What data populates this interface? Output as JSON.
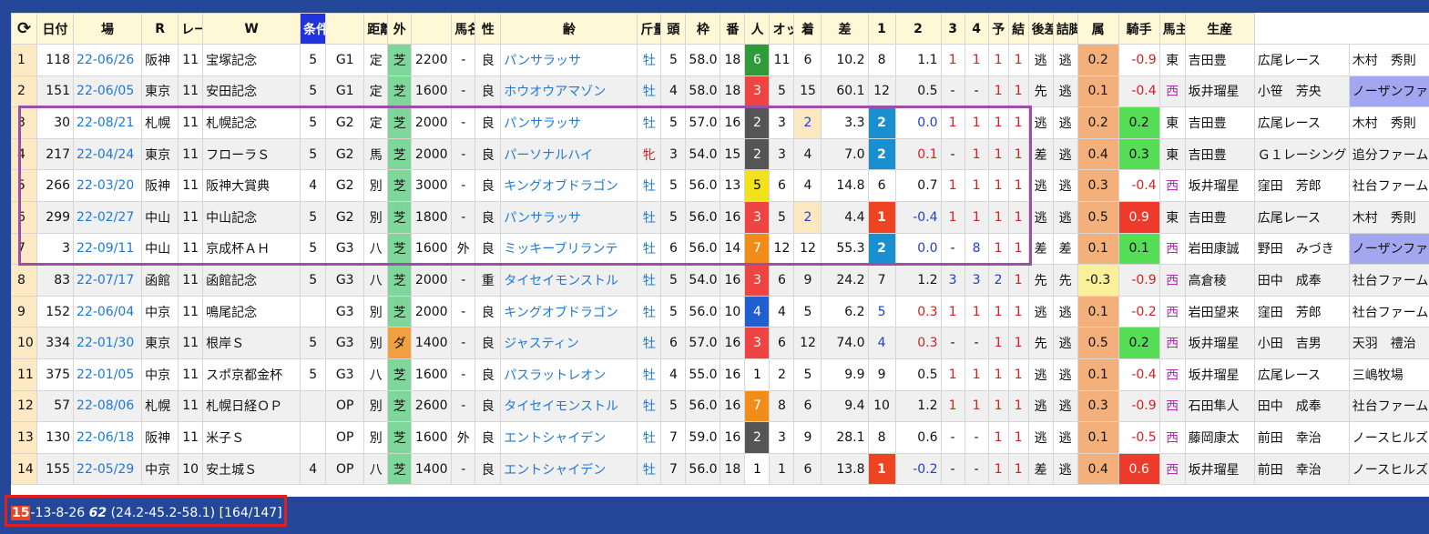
{
  "header": {
    "refresh_icon": "refresh-icon",
    "columns": [
      "",
      "日付",
      "場",
      "R",
      "レース名",
      "W",
      "条件",
      "",
      "距離",
      "外",
      "",
      "馬名",
      "性",
      "齢",
      "斤量",
      "頭",
      "枠",
      "番",
      "人",
      "オッズ",
      "着",
      "差",
      "1",
      "2",
      "3",
      "4",
      "予",
      "結",
      "後差",
      "詰脚",
      "属",
      "騎手",
      "馬主",
      "生産"
    ]
  },
  "rows": [
    [
      "1",
      "118",
      "22-06/26",
      "阪神",
      "11",
      "宝塚記念",
      "5",
      "G1",
      "定",
      "芝",
      "2200",
      "-",
      "良",
      "パンサラッサ",
      "牡",
      "5",
      "58.0",
      "18",
      "6",
      "11",
      "6",
      "10.2",
      "8",
      "1.1",
      "1",
      "1",
      "1",
      "1",
      "逃",
      "逃",
      "0.2",
      "-0.9",
      "東",
      "吉田豊",
      "広尾レース",
      "木村　秀則"
    ],
    [
      "2",
      "151",
      "22-06/05",
      "東京",
      "11",
      "安田記念",
      "5",
      "G1",
      "定",
      "芝",
      "1600",
      "-",
      "良",
      "ホウオウアマゾン",
      "牡",
      "4",
      "58.0",
      "18",
      "3",
      "5",
      "15",
      "60.1",
      "12",
      "0.5",
      "-",
      "-",
      "1",
      "1",
      "先",
      "逃",
      "0.1",
      "-0.4",
      "西",
      "坂井瑠星",
      "小笹　芳央",
      "ノーザンファーム"
    ],
    [
      "3",
      "30",
      "22-08/21",
      "札幌",
      "11",
      "札幌記念",
      "5",
      "G2",
      "定",
      "芝",
      "2000",
      "-",
      "良",
      "パンサラッサ",
      "牡",
      "5",
      "57.0",
      "16",
      "2",
      "3",
      "2",
      "3.3",
      "2",
      "0.0",
      "1",
      "1",
      "1",
      "1",
      "逃",
      "逃",
      "0.2",
      "0.2",
      "東",
      "吉田豊",
      "広尾レース",
      "木村　秀則"
    ],
    [
      "4",
      "217",
      "22-04/24",
      "東京",
      "11",
      "フローラＳ",
      "5",
      "G2",
      "馬",
      "芝",
      "2000",
      "-",
      "良",
      "パーソナルハイ",
      "牝",
      "3",
      "54.0",
      "15",
      "2",
      "3",
      "4",
      "7.0",
      "2",
      "0.1",
      "-",
      "1",
      "1",
      "1",
      "差",
      "逃",
      "0.4",
      "0.3",
      "東",
      "吉田豊",
      "Ｇ１レーシング",
      "追分ファーム"
    ],
    [
      "5",
      "266",
      "22-03/20",
      "阪神",
      "11",
      "阪神大賞典",
      "4",
      "G2",
      "別",
      "芝",
      "3000",
      "-",
      "良",
      "キングオブドラゴン",
      "牡",
      "5",
      "56.0",
      "13",
      "5",
      "6",
      "4",
      "14.8",
      "6",
      "0.7",
      "1",
      "1",
      "1",
      "1",
      "逃",
      "逃",
      "0.3",
      "-0.4",
      "西",
      "坂井瑠星",
      "窪田　芳郎",
      "社台ファーム"
    ],
    [
      "6",
      "299",
      "22-02/27",
      "中山",
      "11",
      "中山記念",
      "5",
      "G2",
      "別",
      "芝",
      "1800",
      "-",
      "良",
      "パンサラッサ",
      "牡",
      "5",
      "56.0",
      "16",
      "3",
      "5",
      "2",
      "4.4",
      "1",
      "-0.4",
      "1",
      "1",
      "1",
      "1",
      "逃",
      "逃",
      "0.5",
      "0.9",
      "東",
      "吉田豊",
      "広尾レース",
      "木村　秀則"
    ],
    [
      "7",
      "3",
      "22-09/11",
      "中山",
      "11",
      "京成杯ＡＨ",
      "5",
      "G3",
      "八",
      "芝",
      "1600",
      "外",
      "良",
      "ミッキーブリランテ",
      "牡",
      "6",
      "56.0",
      "14",
      "7",
      "12",
      "12",
      "55.3",
      "2",
      "0.0",
      "-",
      "8",
      "1",
      "1",
      "差",
      "差",
      "0.1",
      "0.1",
      "西",
      "岩田康誠",
      "野田　みづき",
      "ノーザンファーム"
    ],
    [
      "8",
      "83",
      "22-07/17",
      "函館",
      "11",
      "函館記念",
      "5",
      "G3",
      "八",
      "芝",
      "2000",
      "-",
      "重",
      "タイセイモンストル",
      "牡",
      "5",
      "54.0",
      "16",
      "3",
      "6",
      "9",
      "24.2",
      "7",
      "1.2",
      "3",
      "3",
      "2",
      "1",
      "先",
      "先",
      "-0.3",
      "-0.9",
      "西",
      "高倉稜",
      "田中　成奉",
      "社台ファーム"
    ],
    [
      "9",
      "152",
      "22-06/04",
      "中京",
      "11",
      "鳴尾記念",
      "",
      "G3",
      "別",
      "芝",
      "2000",
      "-",
      "良",
      "キングオブドラゴン",
      "牡",
      "5",
      "56.0",
      "10",
      "4",
      "4",
      "5",
      "6.2",
      "5",
      "0.3",
      "1",
      "1",
      "1",
      "1",
      "逃",
      "逃",
      "0.1",
      "-0.2",
      "西",
      "岩田望来",
      "窪田　芳郎",
      "社台ファーム"
    ],
    [
      "10",
      "334",
      "22-01/30",
      "東京",
      "11",
      "根岸Ｓ",
      "5",
      "G3",
      "別",
      "ダ",
      "1400",
      "-",
      "良",
      "ジャスティン",
      "牡",
      "6",
      "57.0",
      "16",
      "3",
      "6",
      "12",
      "74.0",
      "4",
      "0.3",
      "-",
      "-",
      "1",
      "1",
      "先",
      "逃",
      "0.5",
      "0.2",
      "西",
      "坂井瑠星",
      "小田　吉男",
      "天羽　禮治"
    ],
    [
      "11",
      "375",
      "22-01/05",
      "中京",
      "11",
      "スポ京都金杯",
      "5",
      "G3",
      "八",
      "芝",
      "1600",
      "-",
      "良",
      "パスラットレオン",
      "牡",
      "4",
      "55.0",
      "16",
      "1",
      "2",
      "5",
      "9.9",
      "9",
      "0.5",
      "1",
      "1",
      "1",
      "1",
      "逃",
      "逃",
      "0.1",
      "-0.4",
      "西",
      "坂井瑠星",
      "広尾レース",
      "三嶋牧場"
    ],
    [
      "12",
      "57",
      "22-08/06",
      "札幌",
      "11",
      "札幌日経ＯＰ",
      "",
      "OP",
      "別",
      "芝",
      "2600",
      "-",
      "良",
      "タイセイモンストル",
      "牡",
      "5",
      "56.0",
      "16",
      "7",
      "8",
      "6",
      "9.4",
      "10",
      "1.2",
      "1",
      "1",
      "1",
      "1",
      "逃",
      "逃",
      "0.3",
      "-0.9",
      "西",
      "石田隼人",
      "田中　成奉",
      "社台ファーム"
    ],
    [
      "13",
      "130",
      "22-06/18",
      "阪神",
      "11",
      "米子Ｓ",
      "",
      "OP",
      "別",
      "芝",
      "1600",
      "外",
      "良",
      "エントシャイデン",
      "牡",
      "7",
      "59.0",
      "16",
      "2",
      "3",
      "9",
      "28.1",
      "8",
      "0.6",
      "-",
      "-",
      "1",
      "1",
      "逃",
      "逃",
      "0.1",
      "-0.5",
      "西",
      "藤岡康太",
      "前田　幸治",
      "ノースヒルズ"
    ],
    [
      "14",
      "155",
      "22-05/29",
      "中京",
      "10",
      "安土城Ｓ",
      "4",
      "OP",
      "八",
      "芝",
      "1400",
      "-",
      "良",
      "エントシャイデン",
      "牡",
      "7",
      "56.0",
      "18",
      "1",
      "1",
      "6",
      "13.8",
      "1",
      "-0.2",
      "-",
      "-",
      "1",
      "1",
      "差",
      "逃",
      "0.4",
      "0.6",
      "西",
      "坂井瑠星",
      "前田　幸治",
      "ノースヒルズ"
    ]
  ],
  "footer": {
    "lead": "15",
    "rest": "-13-8-26 ",
    "bold": "62",
    "tail": " (24.2-45.2-58.1) [164/147]"
  },
  "colors": {
    "background": "#24479a",
    "header_bg": "#fff8d6",
    "condition_header": "#2233dd",
    "highlight_box": "#9b4fa6",
    "footer_box": "#e02020"
  }
}
